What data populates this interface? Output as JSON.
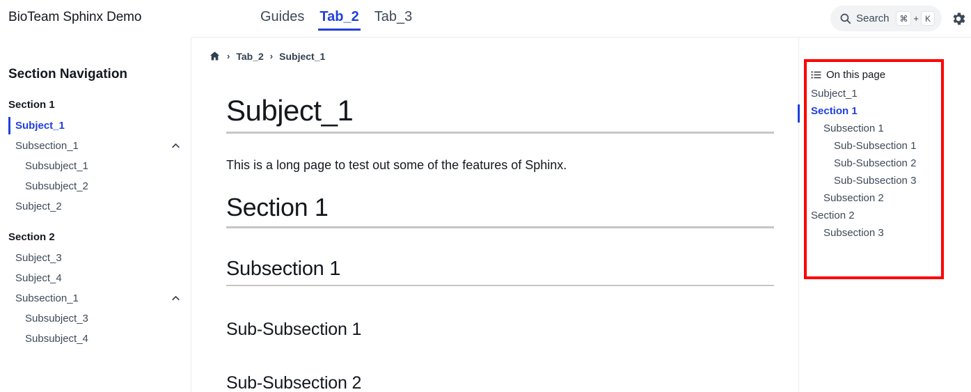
{
  "header": {
    "brand": "BioTeam Sphinx Demo",
    "tabs": [
      {
        "label": "Guides",
        "active": false
      },
      {
        "label": "Tab_2",
        "active": true
      },
      {
        "label": "Tab_3",
        "active": false
      }
    ],
    "search": {
      "label": "Search",
      "icon": "search-icon",
      "shortcut_key_1": "⌘",
      "shortcut_plus": "+",
      "shortcut_key_2": "K"
    },
    "settings_icon": "gear-icon"
  },
  "sidebar": {
    "title": "Section Navigation",
    "groups": [
      {
        "caption": "Section 1",
        "items": [
          {
            "label": "Subject_1",
            "level": 1,
            "current": true,
            "toggle": false
          },
          {
            "label": "Subsection_1",
            "level": 1,
            "current": false,
            "toggle": true
          },
          {
            "label": "Subsubject_1",
            "level": 2,
            "current": false,
            "toggle": false
          },
          {
            "label": "Subsubject_2",
            "level": 2,
            "current": false,
            "toggle": false
          },
          {
            "label": "Subject_2",
            "level": 1,
            "current": false,
            "toggle": false
          }
        ]
      },
      {
        "caption": "Section 2",
        "items": [
          {
            "label": "Subject_3",
            "level": 1,
            "current": false,
            "toggle": false
          },
          {
            "label": "Subject_4",
            "level": 1,
            "current": false,
            "toggle": false
          },
          {
            "label": "Subsection_1",
            "level": 1,
            "current": false,
            "toggle": true
          },
          {
            "label": "Subsubject_3",
            "level": 2,
            "current": false,
            "toggle": false
          },
          {
            "label": "Subsubject_4",
            "level": 2,
            "current": false,
            "toggle": false
          }
        ]
      }
    ]
  },
  "breadcrumb": {
    "home_icon": "home-icon",
    "separator": "›",
    "items": [
      "Tab_2",
      "Subject_1"
    ]
  },
  "article": {
    "h1": "Subject_1",
    "intro": "This is a long page to test out some of the features of Sphinx.",
    "h2": "Section 1",
    "h3": "Subsection 1",
    "h4_1": "Sub-Subsection 1",
    "h4_2": "Sub-Subsection 2"
  },
  "toc": {
    "icon": "list-icon",
    "title": "On this page",
    "items": [
      {
        "label": "Subject_1",
        "level": 1,
        "current": false
      },
      {
        "label": "Section 1",
        "level": 1,
        "current": true
      },
      {
        "label": "Subsection 1",
        "level": 2,
        "current": false
      },
      {
        "label": "Sub-Subsection 1",
        "level": 3,
        "current": false
      },
      {
        "label": "Sub-Subsection 2",
        "level": 3,
        "current": false
      },
      {
        "label": "Sub-Subsection 3",
        "level": 3,
        "current": false
      },
      {
        "label": "Subsection 2",
        "level": 2,
        "current": false
      },
      {
        "label": "Section 2",
        "level": 1,
        "current": false
      },
      {
        "label": "Subsection 3",
        "level": 2,
        "current": false
      }
    ],
    "highlight_color": "#ff0000"
  },
  "colors": {
    "accent": "#1f3fe0",
    "text": "#14181f",
    "muted": "#3d4957",
    "rule": "#c6c6c6",
    "border": "#e9ecef"
  }
}
